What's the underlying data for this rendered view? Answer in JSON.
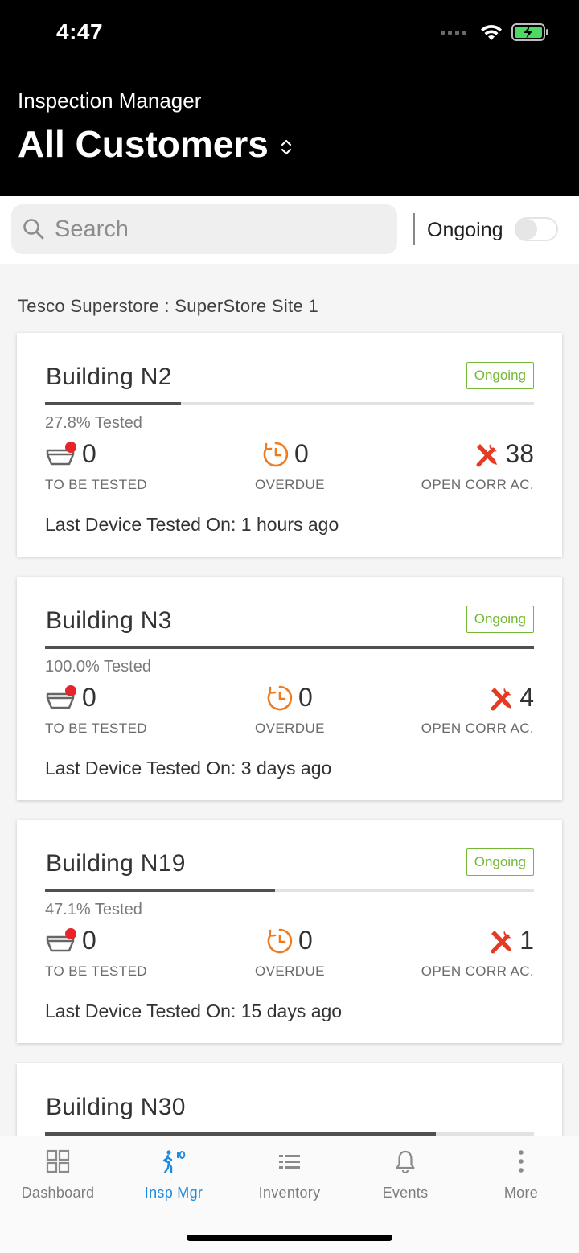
{
  "status_bar": {
    "time": "4:47"
  },
  "header": {
    "subtitle": "Inspection Manager",
    "title": "All Customers"
  },
  "search": {
    "placeholder": "Search",
    "value": ""
  },
  "filter": {
    "label": "Ongoing",
    "on": false
  },
  "site": {
    "label": "Tesco Superstore  : SuperStore Site 1"
  },
  "labels": {
    "to_be_tested": "TO BE TESTED",
    "overdue": "OVERDUE",
    "open_corr": "OPEN CORR AC."
  },
  "buildings": [
    {
      "name": "Building N2",
      "status": "Ongoing",
      "progress": 0.278,
      "pct_text": "27.8% Tested",
      "to_be_tested": "0",
      "overdue": "0",
      "open_corr": "38",
      "last_tested": "Last Device Tested On: 1 hours ago"
    },
    {
      "name": "Building N3",
      "status": "Ongoing",
      "progress": 1.0,
      "pct_text": "100.0% Tested",
      "to_be_tested": "0",
      "overdue": "0",
      "open_corr": "4",
      "last_tested": "Last Device Tested On: 3 days ago"
    },
    {
      "name": "Building N19",
      "status": "Ongoing",
      "progress": 0.471,
      "pct_text": "47.1% Tested",
      "to_be_tested": "0",
      "overdue": "0",
      "open_corr": "1",
      "last_tested": "Last Device Tested On: 15 days ago"
    },
    {
      "name": "Building N30",
      "progress": 0.8
    }
  ],
  "nav": [
    {
      "label": "Dashboard",
      "icon": "dashboard-icon"
    },
    {
      "label": "Insp Mgr",
      "icon": "inspection-icon",
      "active": true
    },
    {
      "label": "Inventory",
      "icon": "inventory-icon"
    },
    {
      "label": "Events",
      "icon": "bell-icon"
    },
    {
      "label": "More",
      "icon": "more-icon"
    }
  ],
  "colors": {
    "accent": "#1c8be0",
    "badge_green": "#75b835",
    "overdue_orange": "#f07a1e",
    "corr_red": "#e53a24",
    "header_bg": "#000000"
  }
}
